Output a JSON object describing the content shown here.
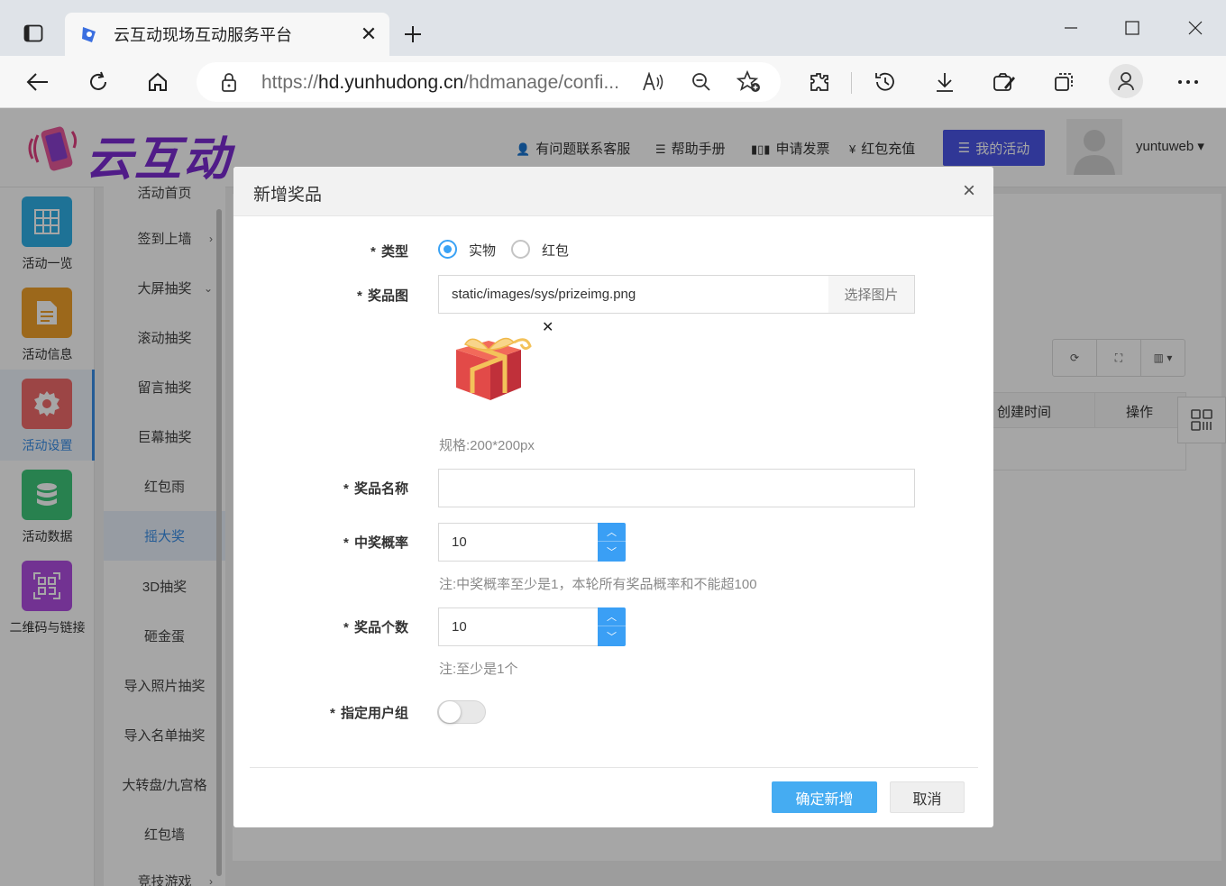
{
  "browser": {
    "tab_title": "云互动现场互动服务平台",
    "url_prefix": "https://",
    "url_main": "hd.yunhudong.cn",
    "url_rest": "/hdmanage/confi..."
  },
  "header": {
    "logo_text": "云互动",
    "nav": [
      {
        "label": "有问题联系客服",
        "icon": "user-plus-icon"
      },
      {
        "label": "帮助手册",
        "icon": "list-icon"
      },
      {
        "label": "申请发票",
        "icon": "barcode-icon"
      },
      {
        "label": "红包充值",
        "icon": "yen-icon"
      }
    ],
    "my_activity": "我的活动",
    "username": "yuntuweb"
  },
  "rail": [
    {
      "label": "活动一览",
      "color": "#2fb0e6"
    },
    {
      "label": "活动信息",
      "color": "#f0a02a"
    },
    {
      "label": "活动设置",
      "color": "#f06a6a"
    },
    {
      "label": "活动数据",
      "color": "#3ec77a"
    },
    {
      "label": "二维码与链接",
      "color": "#b04de0"
    }
  ],
  "submenu": [
    {
      "label": "活动首页"
    },
    {
      "label": "签到上墙"
    },
    {
      "label": "大屏抽奖"
    },
    {
      "label": "滚动抽奖"
    },
    {
      "label": "留言抽奖"
    },
    {
      "label": "巨幕抽奖"
    },
    {
      "label": "红包雨"
    },
    {
      "label": "摇大奖"
    },
    {
      "label": "3D抽奖"
    },
    {
      "label": "砸金蛋"
    },
    {
      "label": "导入照片抽奖"
    },
    {
      "label": "导入名单抽奖"
    },
    {
      "label": "大转盘/九宫格"
    },
    {
      "label": "红包墙"
    },
    {
      "label": "竞技游戏"
    }
  ],
  "table": {
    "col_created": "创建时间",
    "col_action": "操作"
  },
  "modal": {
    "title": "新增奖品",
    "type_label": "类型",
    "type_options": [
      "实物",
      "红包"
    ],
    "type_selected": "实物",
    "image_label": "奖品图",
    "image_value": "static/images/sys/prizeimg.png",
    "image_button": "选择图片",
    "image_spec": "规格:200*200px",
    "name_label": "奖品名称",
    "name_value": "",
    "prob_label": "中奖概率",
    "prob_value": "10",
    "prob_hint": "注:中奖概率至少是1，本轮所有奖品概率和不能超100",
    "count_label": "奖品个数",
    "count_value": "10",
    "count_hint": "注:至少是1个",
    "group_label": "指定用户组",
    "group_enabled": false,
    "confirm": "确定新增",
    "cancel": "取消"
  },
  "colors": {
    "primary": "#45acf2",
    "radio_on": "#3aa2f5",
    "nav_active": "#4a55e6"
  }
}
